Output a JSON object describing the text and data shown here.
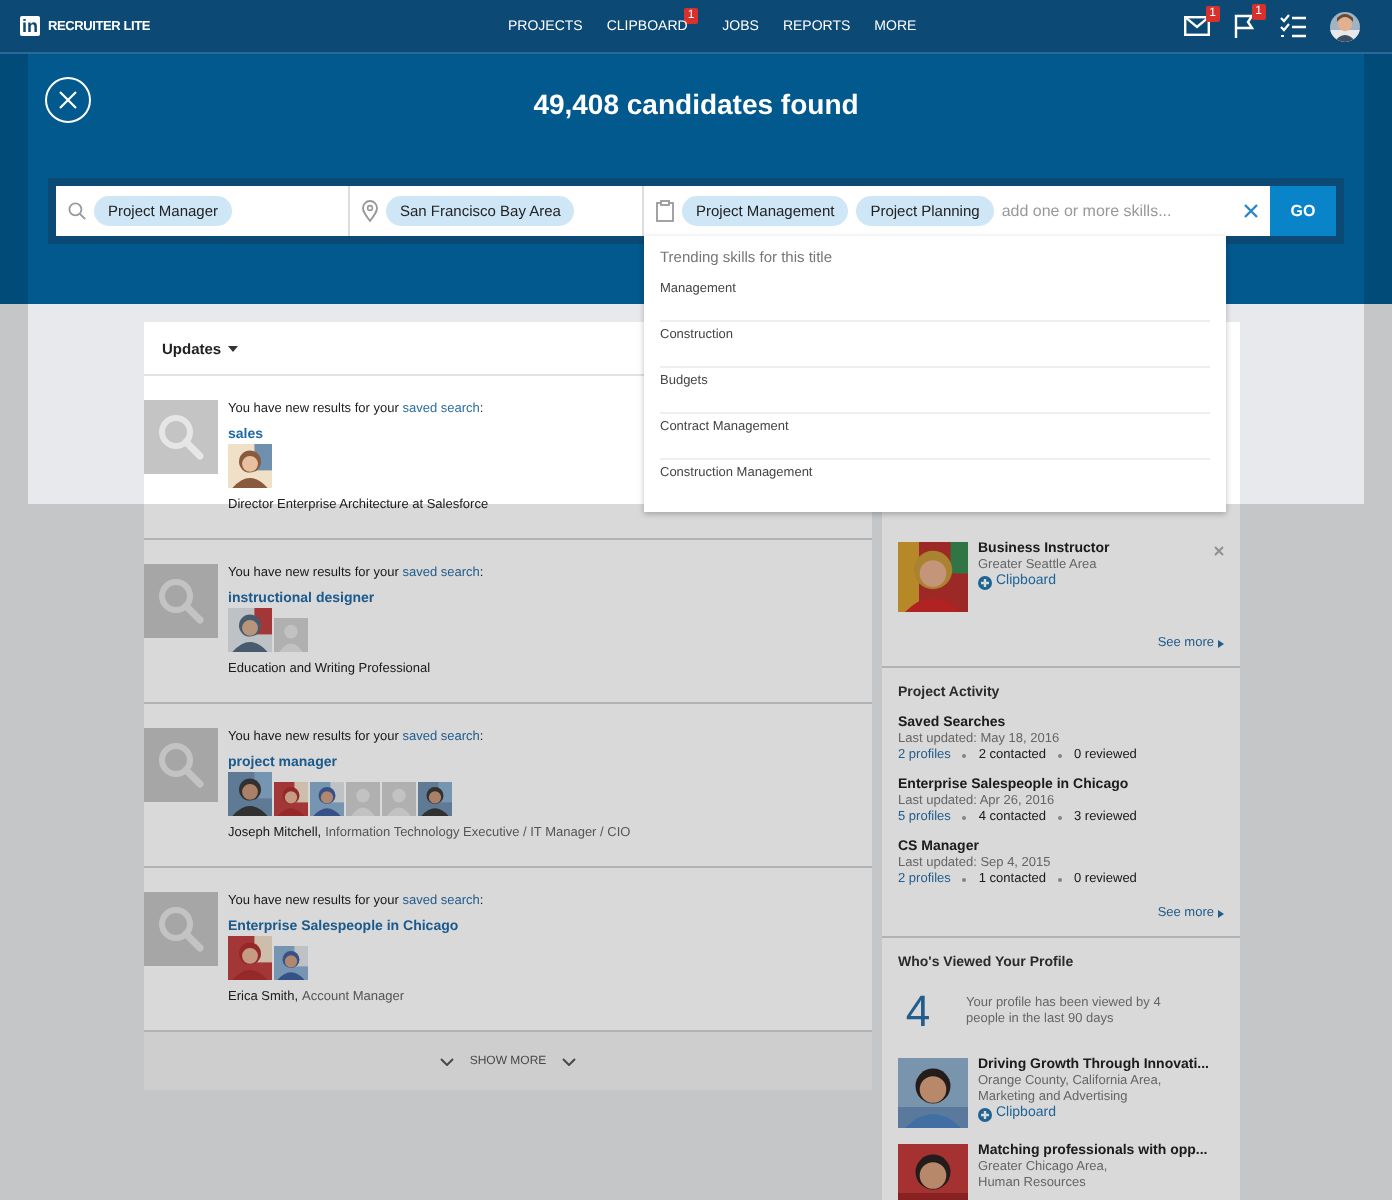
{
  "nav": {
    "logo": "in",
    "brand": "RECRUITER LITE",
    "items": [
      {
        "label": "PROJECTS"
      },
      {
        "label": "CLIPBOARD",
        "badge": "1"
      },
      {
        "label": "JOBS"
      },
      {
        "label": "REPORTS"
      },
      {
        "label": "MORE"
      }
    ],
    "tools": [
      {
        "kind": "mail",
        "badge": "1"
      },
      {
        "kind": "flag",
        "badge": "1"
      },
      {
        "kind": "tasks"
      },
      {
        "kind": "avatar"
      }
    ]
  },
  "search": {
    "title": "49,408 candidates found",
    "fields": [
      {
        "kind": "title",
        "chips": [
          "Project Manager"
        ]
      },
      {
        "kind": "location",
        "chips": [
          "San Francisco Bay Area"
        ]
      },
      {
        "kind": "skills",
        "chips": [
          "Project Management",
          "Project Planning"
        ],
        "placeholder": "add one or more skills..."
      }
    ],
    "go": "GO",
    "dropdown": {
      "heading": "Trending skills for this title",
      "items": [
        "Management",
        "Construction",
        "Budgets",
        "Contract Management",
        "Construction Management"
      ]
    }
  },
  "updates": {
    "title": "Updates",
    "items": [
      {
        "intro": "You have new results for your",
        "link": "saved search",
        "suffix": ":",
        "search": "sales",
        "photos": [
          {
            "kind": "picture"
          }
        ],
        "name": "Director Enterprise Architecture at Salesforce"
      },
      {
        "intro": "You have new results for your",
        "link": "saved search",
        "suffix": ":",
        "search": "instructional designer",
        "photos": [
          {
            "kind": "picture"
          },
          {
            "kind": "placeholder"
          }
        ],
        "name": "Education and Writing Professional"
      },
      {
        "intro": "You have new results for your",
        "link": "saved search",
        "suffix": ":",
        "search": "project manager",
        "photos": [
          {
            "kind": "picture"
          },
          {
            "kind": "picture"
          },
          {
            "kind": "picture"
          },
          {
            "kind": "placeholder"
          },
          {
            "kind": "placeholder"
          },
          {
            "kind": "picture"
          }
        ],
        "name": "Joseph Mitchell,",
        "detail": "Information Technology Executive / IT Manager / CIO"
      },
      {
        "intro": "You have new results for your",
        "link": "saved search",
        "suffix": ":",
        "search": "Enterprise Salespeople in Chicago",
        "photos": [
          {
            "kind": "picture"
          },
          {
            "kind": "picture"
          }
        ],
        "name": "Erica Smith,",
        "detail": "Account Manager"
      }
    ],
    "show_more": "SHOW MORE"
  },
  "suggestion": {
    "title": "Business Instructor",
    "location": "Greater Seattle Area",
    "action": "Clipboard",
    "see_more": "See more"
  },
  "project_activity": {
    "title": "Project Activity",
    "projects": [
      {
        "name": "Saved Searches",
        "updated": "Last updated: May 18, 2016",
        "profiles": "2 profiles",
        "contacted": "2 contacted",
        "reviewed": "0 reviewed"
      },
      {
        "name": "Enterprise Salespeople in Chicago",
        "updated": "Last updated: Apr 26, 2016",
        "profiles": "5 profiles",
        "contacted": "4 contacted",
        "reviewed": "3 reviewed"
      },
      {
        "name": "CS Manager",
        "updated": "Last updated: Sep 4, 2015",
        "profiles": "2 profiles",
        "contacted": "1 contacted",
        "reviewed": "0 reviewed"
      }
    ],
    "see_more": "See more"
  },
  "viewers": {
    "title": "Who's Viewed Your Profile",
    "count": "4",
    "text": "Your profile has been viewed by 4 people in the last 90 days",
    "people": [
      {
        "headline": "Driving Growth Through Innovati...",
        "lines": [
          "Orange County, California Area,",
          "Marketing and Advertising"
        ],
        "action": "Clipboard"
      },
      {
        "headline": "Matching professionals with opp...",
        "lines": [
          "Greater Chicago Area,",
          "Human Resources"
        ]
      }
    ]
  }
}
